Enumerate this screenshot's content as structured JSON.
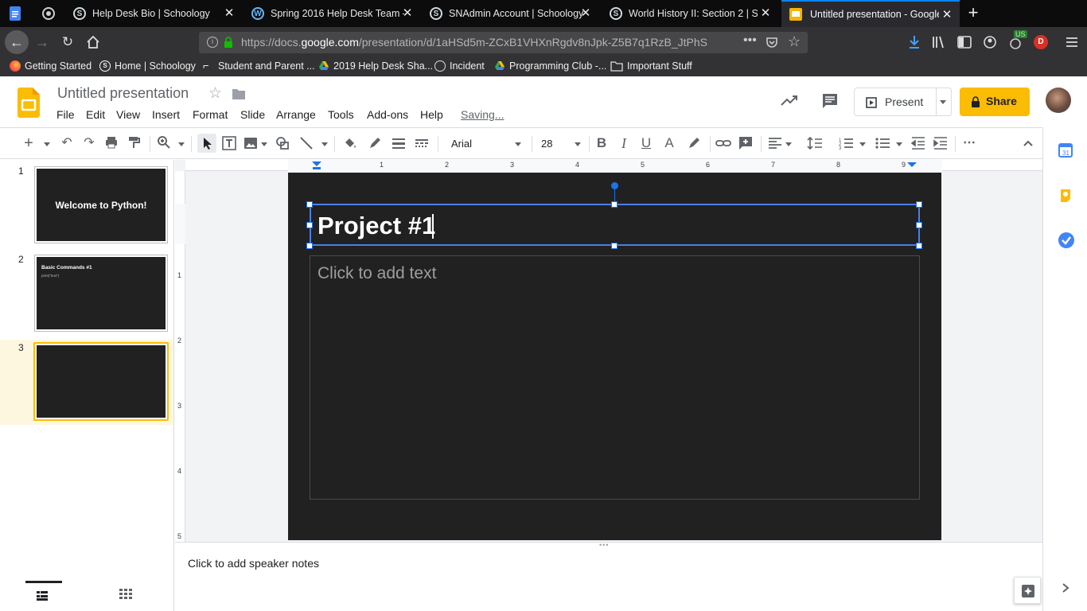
{
  "browser": {
    "tabs": [
      {
        "title": "Help Desk Bio | Schoology",
        "icon": "schoology-icon"
      },
      {
        "title": "Spring 2016 Help Desk Team – ",
        "icon": "wordpress-icon"
      },
      {
        "title": "SNAdmin Account | Schoology",
        "icon": "schoology-icon"
      },
      {
        "title": "World History II: Section 2 | Sch",
        "icon": "schoology-icon"
      },
      {
        "title": "Untitled presentation - Google ",
        "icon": "google-slides-icon",
        "active": true
      }
    ],
    "url_prefix": "https://docs.",
    "url_domain": "google.com",
    "url_rest": "/presentation/d/1aHSd5m-ZCxB1VHXnRgdv8nJpk-Z5B7q1RzB_JtPhS",
    "bookmarks": [
      {
        "label": "Getting Started",
        "icon": "firefox-icon"
      },
      {
        "label": "Home | Schoology",
        "icon": "schoology-icon"
      },
      {
        "label": "Student and Parent ...",
        "icon": "document-icon"
      },
      {
        "label": "2019 Help Desk Sha...",
        "icon": "google-drive-icon"
      },
      {
        "label": "Incident",
        "icon": "globe-icon"
      },
      {
        "label": "Programming Club -...",
        "icon": "google-drive-icon"
      },
      {
        "label": "Important Stuff",
        "icon": "folder-icon"
      }
    ],
    "extension_badge": "US",
    "profile_badge": "D"
  },
  "doc": {
    "title": "Untitled presentation",
    "menus": [
      "File",
      "Edit",
      "View",
      "Insert",
      "Format",
      "Slide",
      "Arrange",
      "Tools",
      "Add-ons",
      "Help"
    ],
    "status": "Saving...",
    "present_label": "Present",
    "share_label": "Share",
    "accent": "#fbbc04"
  },
  "toolbar": {
    "font": "Arial",
    "font_size": "28"
  },
  "ruler": {
    "h_marks": [
      "1",
      "2",
      "3",
      "4",
      "5",
      "6",
      "7",
      "8",
      "9"
    ],
    "v_marks": [
      "1",
      "2",
      "3",
      "4",
      "5"
    ]
  },
  "slides": [
    {
      "number": "1",
      "title": "Welcome to Python!",
      "body": ""
    },
    {
      "number": "2",
      "title": "Basic Commands #1",
      "body": "print(\"text\")"
    },
    {
      "number": "3",
      "title": "",
      "body": "",
      "selected": true
    }
  ],
  "current_slide": {
    "title": "Project #1",
    "body_placeholder": "Click to add text"
  },
  "notes_placeholder": "Click to add speaker notes"
}
